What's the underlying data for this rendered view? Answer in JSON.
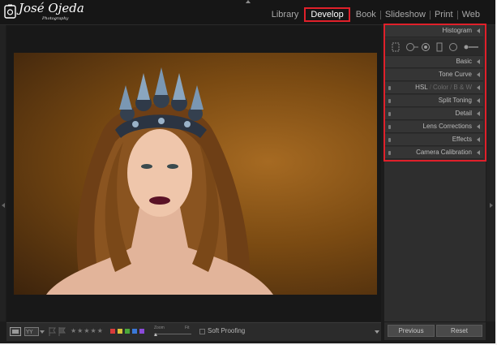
{
  "branding": {
    "name": "José Ojeda",
    "tagline": "Photography"
  },
  "modules": [
    {
      "label": "Library",
      "active": false
    },
    {
      "label": "Develop",
      "active": true
    },
    {
      "label": "Book",
      "active": false
    },
    {
      "label": "Slideshow",
      "active": false
    },
    {
      "label": "Print",
      "active": false
    },
    {
      "label": "Web",
      "active": false
    }
  ],
  "panels": {
    "histogram": "Histogram",
    "basic": "Basic",
    "tone_curve": "Tone Curve",
    "hsl": {
      "hsl": "HSL",
      "color": "Color",
      "bw": "B & W",
      "separator": "/"
    },
    "split_toning": "Split Toning",
    "detail": "Detail",
    "lens_corrections": "Lens Corrections",
    "effects": "Effects",
    "camera_calibration": "Camera Calibration"
  },
  "toolbar": {
    "rating_stars": "★★★★★",
    "zoom_label": "Zoom",
    "fit_label": "Fit",
    "soft_proofing": "Soft Proofing",
    "color_labels": [
      "#d83a3a",
      "#d8c23a",
      "#4aa83a",
      "#3a78d8",
      "#8a4ad8"
    ]
  },
  "buttons": {
    "previous": "Previous",
    "reset": "Reset"
  },
  "colors": {
    "highlight": "#e0202a",
    "panel_bg": "#2e2e2e",
    "app_bg": "#1c1c1c"
  }
}
